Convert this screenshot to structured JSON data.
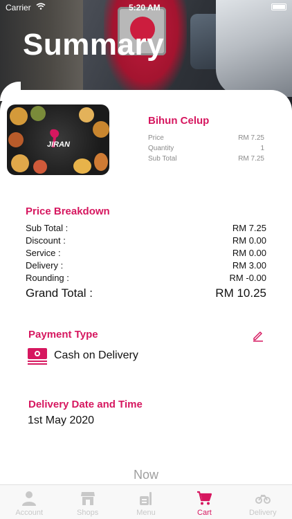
{
  "status_bar": {
    "carrier": "Carrier",
    "time": "5:20 AM"
  },
  "header": {
    "title": "Summary"
  },
  "product": {
    "name": "Bihun Celup",
    "logo_text": "JIRAN",
    "rows": [
      {
        "label": "Price",
        "value": "RM 7.25"
      },
      {
        "label": "Quantity",
        "value": "1"
      },
      {
        "label": "Sub Total",
        "value": "RM 7.25"
      }
    ]
  },
  "price_breakdown": {
    "title": "Price Breakdown",
    "rows": [
      {
        "label": "Sub Total :",
        "value": "RM 7.25"
      },
      {
        "label": "Discount :",
        "value": "RM 0.00"
      },
      {
        "label": "Service :",
        "value": "RM 0.00"
      },
      {
        "label": "Delivery :",
        "value": "RM 3.00"
      },
      {
        "label": "Rounding :",
        "value": "RM -0.00"
      }
    ],
    "grand_total": {
      "label": "Grand Total :",
      "value": "RM 10.25"
    }
  },
  "payment": {
    "title": "Payment Type",
    "value": "Cash on Delivery"
  },
  "delivery": {
    "title": "Delivery Date and Time",
    "value": "1st May 2020"
  },
  "now_button": "Now",
  "tabs": [
    {
      "label": "Account",
      "icon": "person-icon",
      "active": false
    },
    {
      "label": "Shops",
      "icon": "store-icon",
      "active": false
    },
    {
      "label": "Menu",
      "icon": "menu-icon",
      "active": false
    },
    {
      "label": "Cart",
      "icon": "cart-icon",
      "active": true
    },
    {
      "label": "Delivery",
      "icon": "motorcycle-icon",
      "active": false
    }
  ],
  "colors": {
    "accent": "#d6175f",
    "muted": "#8a8a8a",
    "inactive_tab": "#c8c8c8"
  }
}
